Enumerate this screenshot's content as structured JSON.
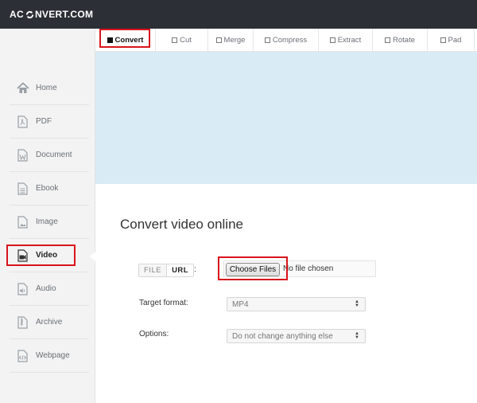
{
  "brand": {
    "logo_left": "AC",
    "logo_right": "NVERT.COM"
  },
  "sidebar": {
    "items": [
      {
        "label": "Home",
        "icon": "home-icon"
      },
      {
        "label": "PDF",
        "icon": "pdf-icon"
      },
      {
        "label": "Document",
        "icon": "document-icon"
      },
      {
        "label": "Ebook",
        "icon": "ebook-icon"
      },
      {
        "label": "Image",
        "icon": "image-icon"
      },
      {
        "label": "Video",
        "icon": "video-icon",
        "active": true
      },
      {
        "label": "Audio",
        "icon": "audio-icon"
      },
      {
        "label": "Archive",
        "icon": "archive-icon"
      },
      {
        "label": "Webpage",
        "icon": "webpage-icon"
      }
    ]
  },
  "tabs": [
    {
      "label": "Convert",
      "active": true
    },
    {
      "label": "Cut"
    },
    {
      "label": "Merge"
    },
    {
      "label": "Compress"
    },
    {
      "label": "Extract"
    },
    {
      "label": "Rotate"
    },
    {
      "label": "Pad"
    }
  ],
  "main": {
    "title": "Convert video online",
    "source_toggle": {
      "file": "FILE",
      "url": "URL"
    },
    "colon": ":",
    "choose_button": "Choose Files",
    "no_file": "No file chosen",
    "target_format_label": "Target format:",
    "target_format_value": "MP4",
    "options_label": "Options:",
    "options_value": "Do not change anything else"
  },
  "colors": {
    "topbar": "#2c3036",
    "banner": "#d9ebf4",
    "highlight": "#d8141b",
    "sidebar": "#f3f3f3"
  }
}
